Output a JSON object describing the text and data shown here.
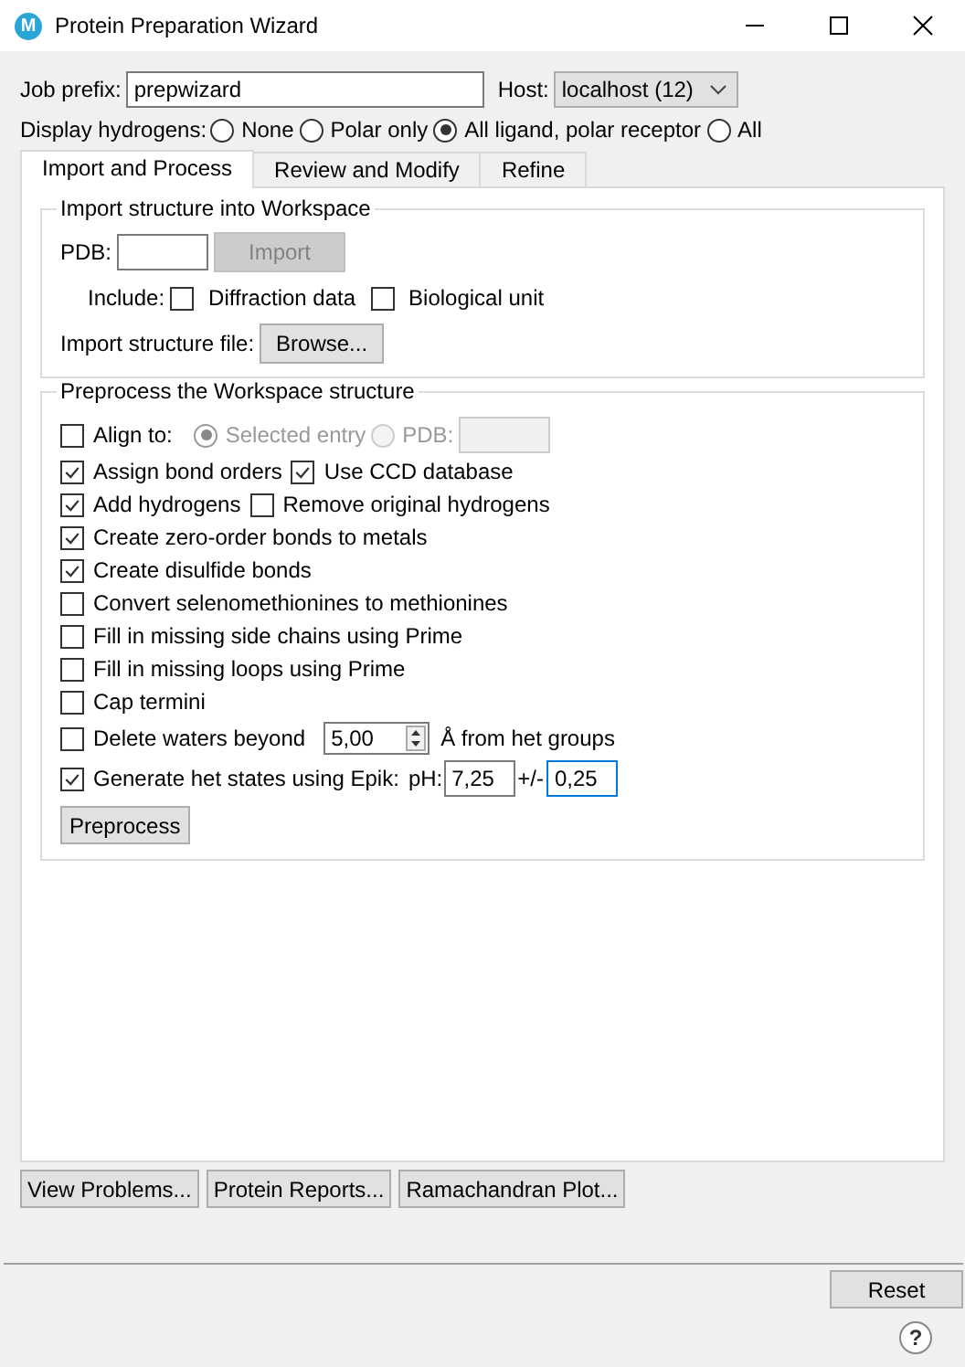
{
  "window": {
    "title": "Protein Preparation Wizard",
    "logo": "M"
  },
  "job_prefix": {
    "label": "Job prefix:",
    "value": "prepwizard"
  },
  "host": {
    "label": "Host:",
    "value": "localhost (12)"
  },
  "display_hydrogens": {
    "label": "Display hydrogens:",
    "options": [
      {
        "label": "None",
        "selected": false
      },
      {
        "label": "Polar only",
        "selected": false
      },
      {
        "label": "All ligand, polar receptor",
        "selected": true
      },
      {
        "label": "All",
        "selected": false
      }
    ]
  },
  "tabs": [
    {
      "label": "Import and Process",
      "selected": true
    },
    {
      "label": "Review and Modify",
      "selected": false
    },
    {
      "label": "Refine",
      "selected": false
    }
  ],
  "import_group": {
    "title": "Import structure into Workspace",
    "pdb_label": "PDB:",
    "import_button": {
      "label": "Import",
      "disabled": true
    },
    "include_label": "Include:",
    "include": [
      {
        "label": "Diffraction data",
        "checked": false
      },
      {
        "label": "Biological unit",
        "checked": false
      }
    ],
    "file_label": "Import structure file:",
    "browse_button": "Browse..."
  },
  "preprocess_group": {
    "title": "Preprocess the Workspace structure",
    "options": [
      {
        "kind": "align",
        "label": "Align to:",
        "checked": false,
        "radios": [
          {
            "label": "Selected entry",
            "selected": true
          },
          {
            "label": "PDB:",
            "selected": false
          }
        ]
      },
      {
        "kind": "pair",
        "label": "Assign bond orders",
        "checked": true,
        "extra": {
          "label": "Use CCD database",
          "checked": true
        }
      },
      {
        "kind": "pair",
        "label": "Add hydrogens",
        "checked": true,
        "extra": {
          "label": "Remove original hydrogens",
          "checked": false
        }
      },
      {
        "kind": "check",
        "label": "Create zero-order bonds to metals",
        "checked": true
      },
      {
        "kind": "check",
        "label": "Create disulfide bonds",
        "checked": true
      },
      {
        "kind": "check",
        "label": "Convert selenomethionines to methionines",
        "checked": false
      },
      {
        "kind": "check",
        "label": "Fill in missing side chains using Prime",
        "checked": false
      },
      {
        "kind": "check",
        "label": "Fill in missing loops using Prime",
        "checked": false
      },
      {
        "kind": "check",
        "label": "Cap termini",
        "checked": false
      },
      {
        "kind": "spin",
        "label": "Delete waters beyond",
        "checked": false,
        "value": "5,00",
        "suffix": "Å from het groups"
      },
      {
        "kind": "epik",
        "label": "Generate het states using Epik:",
        "checked": true,
        "ph_label": "pH:",
        "ph": "7,25",
        "tol_label": "+/-",
        "tol": "0,25"
      }
    ],
    "button": "Preprocess"
  },
  "bottom_buttons": [
    "View Problems...",
    "Protein Reports...",
    "Ramachandran Plot..."
  ],
  "reset_button": "Reset",
  "help": "?"
}
